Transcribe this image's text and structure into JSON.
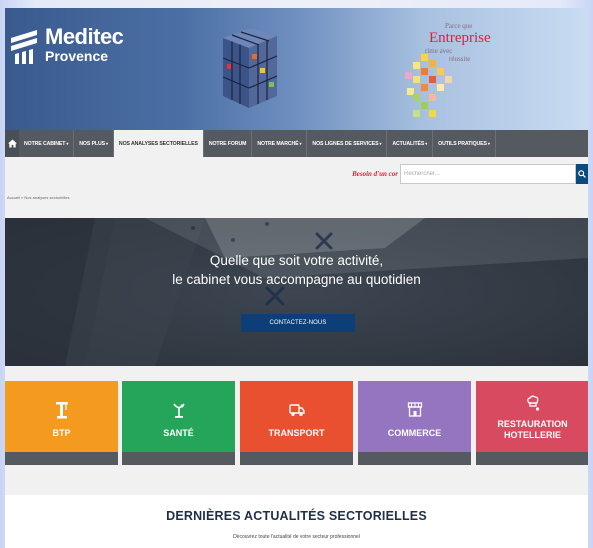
{
  "header": {
    "logo_line1": "Meditec",
    "logo_line2": "Provence",
    "tagline_small1": "Parce que",
    "tagline_big": "Entreprise",
    "tagline_small2": "rime avec",
    "tagline_small3": "réussite"
  },
  "nav": {
    "home_icon": "home-icon",
    "items": [
      {
        "label": "NOTRE CABINET",
        "caret": "▾"
      },
      {
        "label": "NOS PLUS",
        "caret": "▾"
      },
      {
        "label": "NOS ANALYSES SECTORIELLES",
        "caret": ""
      },
      {
        "label": "NOTRE FORUM",
        "caret": ""
      },
      {
        "label": "NOTRE MARCHÉ",
        "caret": "▾"
      },
      {
        "label": "NOS LIGNES DE SERVICES",
        "caret": "▾"
      },
      {
        "label": "ACTUALITÉS",
        "caret": "▾"
      },
      {
        "label": "OUTILS PRATIQUES",
        "caret": "▾"
      }
    ],
    "active_index": 2,
    "bg_color": "#555a60"
  },
  "search": {
    "besoin_label": "Besoin d'un cor",
    "placeholder": "Rechercher...",
    "button_icon": "search-icon",
    "button_color": "#0b4a7f"
  },
  "breadcrumb": {
    "home": "Accueil",
    "separator": "»",
    "current": "Nos analyses sectorielles"
  },
  "hero": {
    "line1": "Quelle que soit votre activité,",
    "line2": "le cabinet vous accompagne au quotidien",
    "cta_label": "CONTACTEZ-NOUS",
    "cta_color": "#0c3f78"
  },
  "sectors": [
    {
      "label1": "BTP",
      "label2": "",
      "icon": "crane-icon",
      "color": "#f39a1f"
    },
    {
      "label1": "SANTÉ",
      "label2": "",
      "icon": "caduceus-icon",
      "color": "#25a55a"
    },
    {
      "label1": "TRANSPORT",
      "label2": "",
      "icon": "truck-icon",
      "color": "#e9502f"
    },
    {
      "label1": "COMMERCE",
      "label2": "",
      "icon": "shop-icon",
      "color": "#9574c0"
    },
    {
      "label1": "RESTAURATION",
      "label2": "HOTELLERIE",
      "icon": "chef-hat-icon",
      "color": "#d84a5f"
    }
  ],
  "news": {
    "title": "DERNIÈRES ACTUALITÉS SECTORIELLES",
    "subtitle": "Découvrez toute l'actualité de votre secteur professionnel"
  }
}
